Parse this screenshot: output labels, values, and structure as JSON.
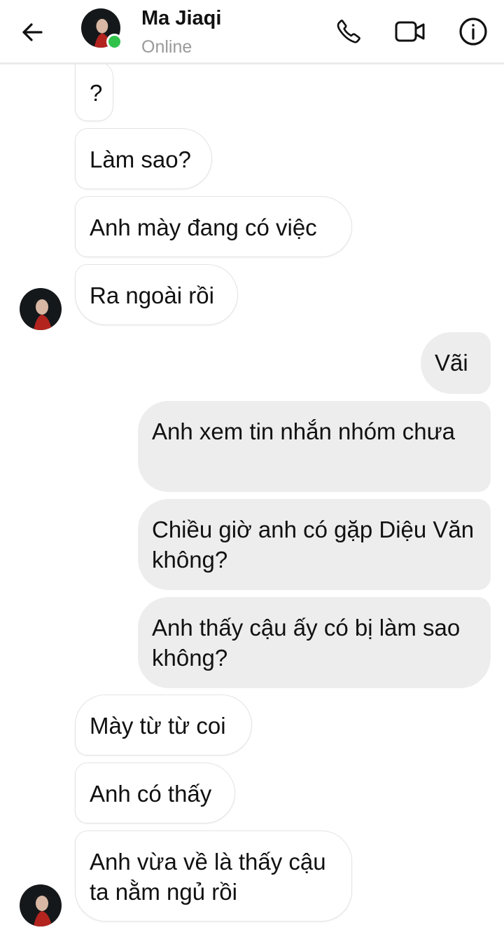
{
  "header": {
    "contact_name": "Ma Jiaqi",
    "status": "Online",
    "icons": [
      "back-arrow-icon",
      "phone-icon",
      "video-camera-icon",
      "info-icon"
    ],
    "online_color": "#31c24b"
  },
  "messages": [
    {
      "direction": "received",
      "text": "?"
    },
    {
      "direction": "received",
      "text": "Làm sao?"
    },
    {
      "direction": "received",
      "text": "Anh mày đang có việc"
    },
    {
      "direction": "received",
      "text": "Ra ngoài rồi"
    },
    {
      "direction": "sent",
      "text": "Vãi"
    },
    {
      "direction": "sent",
      "text": "Anh xem tin nhắn nhóm chưa"
    },
    {
      "direction": "sent",
      "text": "Chiều giờ anh có gặp Diệu Văn không?"
    },
    {
      "direction": "sent",
      "text": "Anh thấy cậu ấy có bị làm sao không?"
    },
    {
      "direction": "received",
      "text": "Mày từ từ coi"
    },
    {
      "direction": "received",
      "text": "Anh có thấy"
    },
    {
      "direction": "received",
      "text": "Anh vừa về là thấy cậu ta nằm ngủ rồi"
    }
  ],
  "colors": {
    "sent_bubble": "#ededed",
    "received_bubble": "#ffffff"
  }
}
